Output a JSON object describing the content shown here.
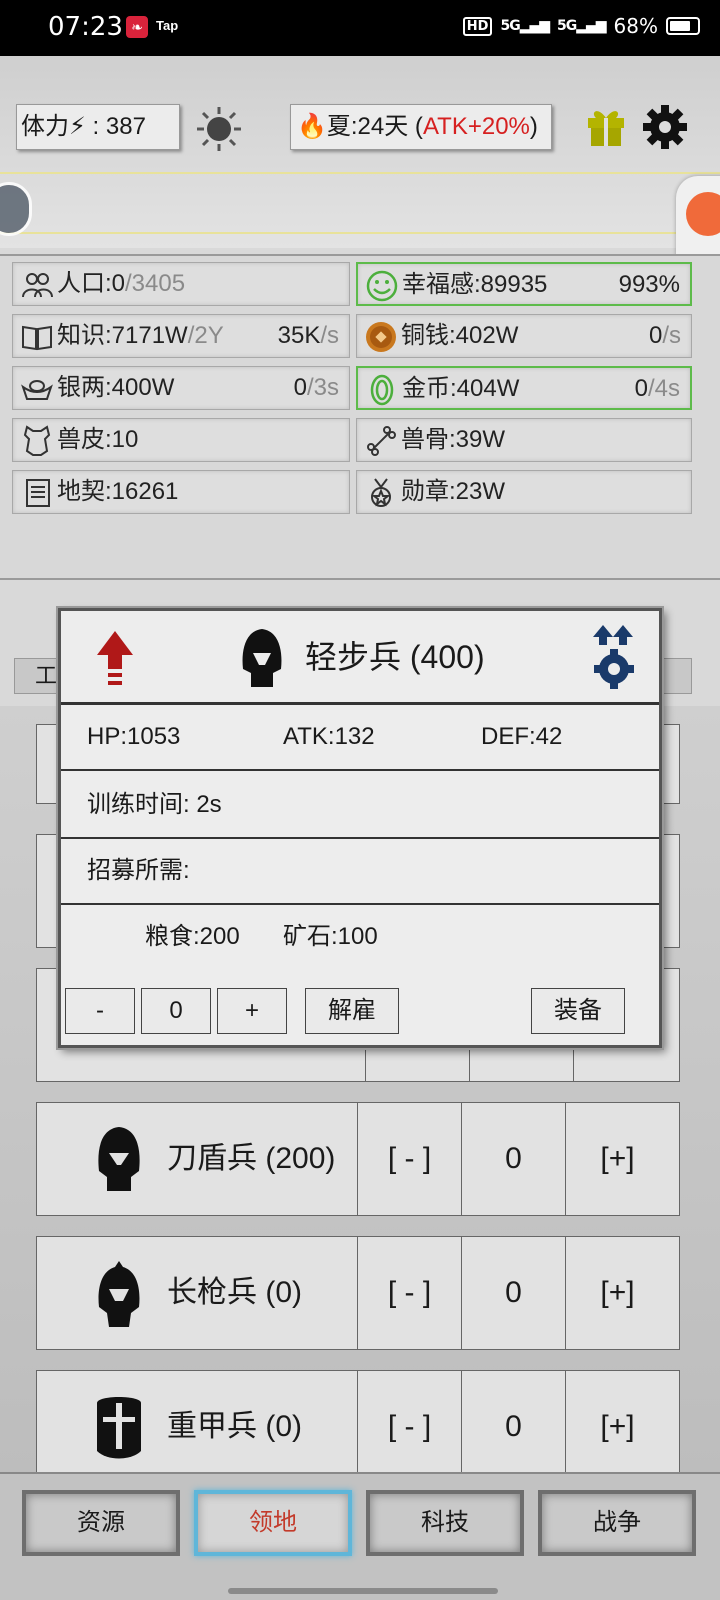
{
  "status_bar": {
    "time": "07:23",
    "app_badge": "Tap",
    "hd": "HD",
    "signal1": "5G",
    "signal2": "5G",
    "battery": "68%",
    "battery_level": 0.68
  },
  "top": {
    "stamina_label": "体力",
    "stamina_value": "387",
    "season_text": "夏:24天",
    "season_bonus": "ATK+20%"
  },
  "resources": [
    {
      "icon": "people-icon",
      "label": "人口:0",
      "extra": "/3405",
      "rate": "",
      "green": false
    },
    {
      "icon": "smile-icon",
      "label": "幸福感:89935",
      "extra": "",
      "rate": "993%",
      "green": true
    },
    {
      "icon": "book-icon",
      "label": "知识:7171W",
      "extra": "/2Y",
      "rate": "35K",
      "rate_unit": "/s",
      "green": false
    },
    {
      "icon": "coin-icon",
      "label": "铜钱:402W",
      "extra": "",
      "rate": "0",
      "rate_unit": "/s",
      "green": false
    },
    {
      "icon": "silver-ingot-icon",
      "label": "银两:400W",
      "extra": "",
      "rate": "0",
      "rate_unit": "/3s",
      "green": false
    },
    {
      "icon": "gold-coin-icon",
      "label": "金币:404W",
      "extra": "",
      "rate": "0",
      "rate_unit": "/4s",
      "green": true
    },
    {
      "icon": "hide-icon",
      "label": "兽皮:10",
      "extra": "",
      "rate": "",
      "green": false
    },
    {
      "icon": "bone-icon",
      "label": "兽骨:39W",
      "extra": "",
      "rate": "",
      "green": false
    },
    {
      "icon": "deed-icon",
      "label": "地契:16261",
      "extra": "",
      "rate": "",
      "green": false
    },
    {
      "icon": "medal-icon",
      "label": "勋章:23W",
      "extra": "",
      "rate": "",
      "green": false
    }
  ],
  "tab_hint": "工",
  "units": [
    {
      "name": "刀盾兵 (200)",
      "minus": "[ - ]",
      "count": "0",
      "plus": "[+]"
    },
    {
      "name": "长枪兵 (0)",
      "minus": "[ - ]",
      "count": "0",
      "plus": "[+]"
    },
    {
      "name": "重甲兵 (0)",
      "minus": "[ - ]",
      "count": "0",
      "plus": "[+]"
    }
  ],
  "dialog": {
    "title": "轻步兵 (400)",
    "hp": "HP:1053",
    "atk": "ATK:132",
    "def": "DEF:42",
    "train_time": "训练时间: 2s",
    "recruit_label": "招募所需:",
    "cost_food": "粮食:200",
    "cost_ore": "矿石:100",
    "minus": "-",
    "count": "0",
    "plus": "+",
    "dismiss": "解雇",
    "equip": "装备"
  },
  "nav": [
    {
      "label": "资源",
      "active": false
    },
    {
      "label": "领地",
      "active": true
    },
    {
      "label": "科技",
      "active": false
    },
    {
      "label": "战争",
      "active": false
    }
  ],
  "colors": {
    "accent_blue": "#5fb6d9",
    "bonus_red": "#d62020",
    "green_border": "#5dbb4a"
  }
}
